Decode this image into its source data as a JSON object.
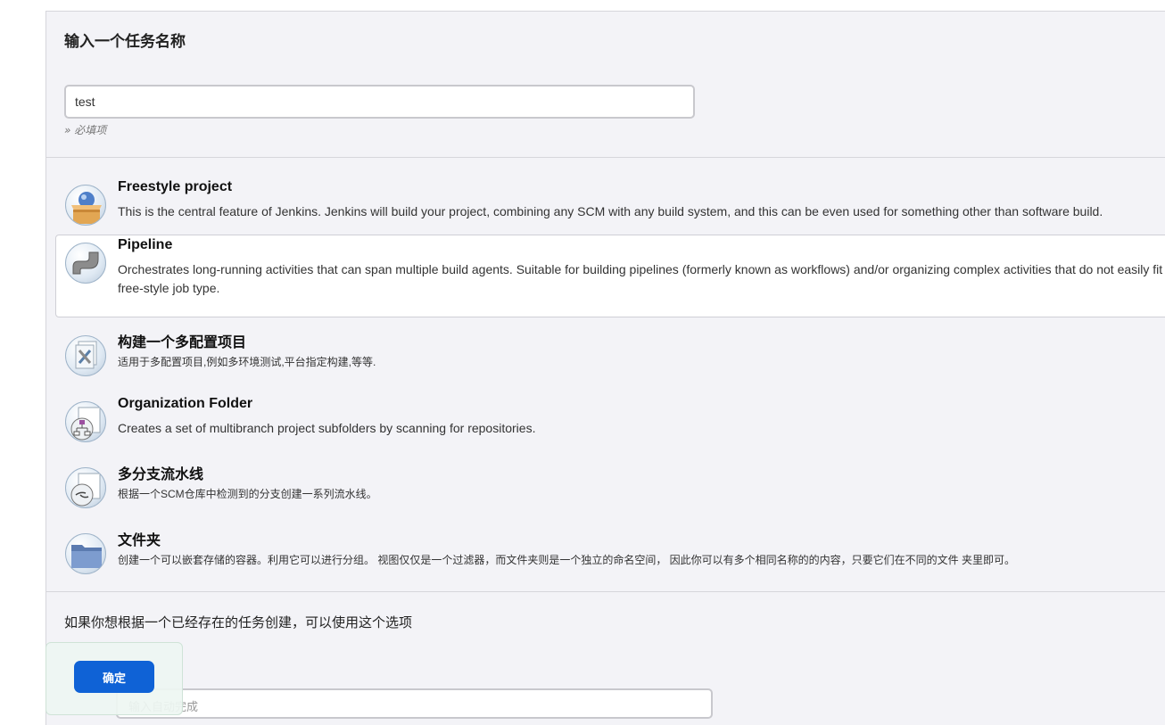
{
  "heading": "输入一个任务名称",
  "name_input": {
    "value": "test"
  },
  "required_hint": "» 必填项",
  "items": [
    {
      "title": "Freestyle project",
      "description": "This is the central feature of Jenkins. Jenkins will build your project, combining any SCM with any build system, and this can be even used for something other than software build.",
      "icon": "freestyle-box-icon"
    },
    {
      "title": "Pipeline",
      "description": "Orchestrates long-running activities that can span multiple build agents. Suitable for building pipelines (formerly known as workflows) and/or organizing complex activities that do not easily fit in free-style job type.",
      "icon": "pipeline-icon",
      "selected": true
    },
    {
      "title": "构建一个多配置项目",
      "description": "适用于多配置项目,例如多环境测试,平台指定构建,等等.",
      "icon": "multi-config-icon"
    },
    {
      "title": "Organization Folder",
      "description": "Creates a set of multibranch project subfolders by scanning for repositories.",
      "icon": "organization-folder-icon"
    },
    {
      "title": "多分支流水线",
      "description": "根据一个SCM仓库中检测到的分支创建一系列流水线。",
      "icon": "multibranch-icon"
    },
    {
      "title": "文件夹",
      "description": "创建一个可以嵌套存储的容器。利用它可以进行分组。 视图仅仅是一个过滤器，而文件夹则是一个独立的命名空间， 因此你可以有多个相同名称的的内容，只要它们在不同的文件 夹里即可。",
      "icon": "folder-icon"
    }
  ],
  "copy_section": {
    "text": "如果你想根据一个已经存在的任务创建，可以使用这个选项",
    "input_placeholder": "输入自动完成"
  },
  "ok_button": "确定"
}
